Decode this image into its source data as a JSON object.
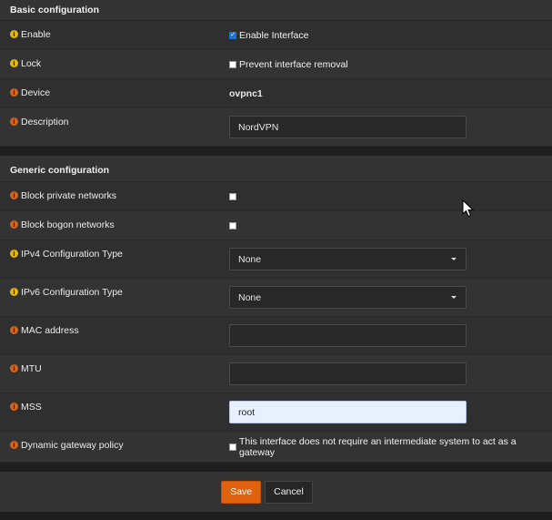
{
  "basic": {
    "header": "Basic configuration",
    "enable": {
      "label": "Enable",
      "checked": true,
      "checkbox_label": "Enable Interface"
    },
    "lock": {
      "label": "Lock",
      "checked": false,
      "checkbox_label": "Prevent interface removal"
    },
    "device": {
      "label": "Device",
      "value": "ovpnc1"
    },
    "description": {
      "label": "Description",
      "value": "NordVPN"
    }
  },
  "generic": {
    "header": "Generic configuration",
    "block_private": {
      "label": "Block private networks",
      "checked": false
    },
    "block_bogon": {
      "label": "Block bogon networks",
      "checked": false
    },
    "ipv4_type": {
      "label": "IPv4 Configuration Type",
      "value": "None"
    },
    "ipv6_type": {
      "label": "IPv6 Configuration Type",
      "value": "None"
    },
    "mac": {
      "label": "MAC address",
      "value": ""
    },
    "mtu": {
      "label": "MTU",
      "value": ""
    },
    "mss": {
      "label": "MSS",
      "value": "root"
    },
    "gateway_policy": {
      "label": "Dynamic gateway policy",
      "checked": false,
      "checkbox_label": "This interface does not require an intermediate system to act as a gateway"
    }
  },
  "buttons": {
    "save": "Save",
    "cancel": "Cancel"
  },
  "icons": {
    "info": "info-icon",
    "check": "check-icon",
    "caret": "caret-down-icon",
    "cursor": "mouse-pointer-icon"
  },
  "colors": {
    "accent": "#e0620e",
    "info_yellow": "#e2b70f",
    "info_orange": "#d4651b",
    "checkbox_checked": "#1b73d8"
  }
}
